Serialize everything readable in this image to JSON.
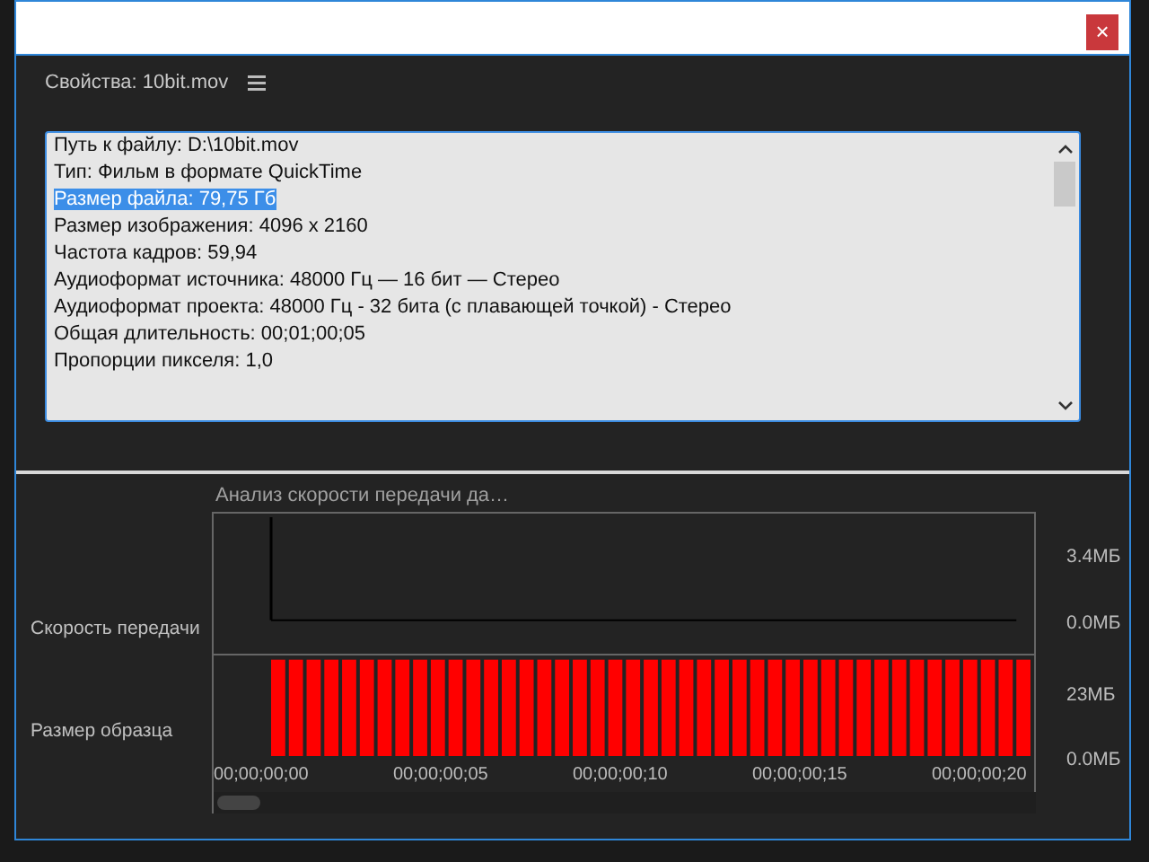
{
  "window": {
    "close_label": "×"
  },
  "panel": {
    "title": "Свойства: 10bit.mov"
  },
  "properties": [
    {
      "text": "Путь к файлу: D:\\10bit.mov",
      "selected": false
    },
    {
      "text": "Тип: Фильм в формате QuickTime",
      "selected": false
    },
    {
      "text": "Размер файла: 79,75 Гб",
      "selected": true
    },
    {
      "text": "Размер изображения: 4096 x 2160",
      "selected": false
    },
    {
      "text": "Частота кадров: 59,94",
      "selected": false
    },
    {
      "text": "Аудиоформат источника: 48000 Гц — 16 бит — Стерео",
      "selected": false
    },
    {
      "text": "Аудиоформат проекта: 48000 Гц - 32 бита (с плавающей точкой) - Стерео",
      "selected": false
    },
    {
      "text": "Общая длительность: 00;01;00;05",
      "selected": false
    },
    {
      "text": "Пропорции пикселя: 1,0",
      "selected": false
    }
  ],
  "analysis": {
    "title": "Анализ скорости передачи да…",
    "xticks": [
      "00;00;00;00",
      "00;00;00;05",
      "00;00;00;10",
      "00;00;00;15",
      "00;00;00;20"
    ],
    "charts": [
      {
        "label": "Скорость передачи",
        "chart_data": {
          "type": "line",
          "ylim": [
            -1.7,
            5.4
          ],
          "yticks": [
            {
              "value": 0,
              "label": "0.0МБ"
            },
            {
              "value": 3.4,
              "label": "3.4МБ"
            }
          ],
          "series": [
            {
              "color": "#000000",
              "values": [
                0,
                0,
                0,
                0,
                0,
                0,
                0,
                0,
                0,
                0,
                0,
                0,
                0,
                0,
                0,
                0,
                0,
                0,
                0,
                0,
                0,
                0,
                0,
                0,
                0,
                0,
                0,
                0,
                0,
                0,
                0,
                0,
                0,
                0,
                0,
                0,
                0,
                0,
                0,
                0,
                0,
                0,
                0
              ]
            }
          ]
        }
      },
      {
        "label": "Размер образца",
        "chart_data": {
          "type": "bar",
          "ylim": [
            0,
            36
          ],
          "yticks": [
            {
              "value": 0,
              "label": "0.0МБ"
            },
            {
              "value": 23,
              "label": "23МБ"
            }
          ],
          "series": [
            {
              "color": "#ff0000",
              "values": [
                34.5,
                34.5,
                34.5,
                34.5,
                34.5,
                34.5,
                34.5,
                34.5,
                34.5,
                34.5,
                34.5,
                34.5,
                34.5,
                34.5,
                34.5,
                34.5,
                34.5,
                34.5,
                34.5,
                34.5,
                34.5,
                34.5,
                34.5,
                34.5,
                34.5,
                34.5,
                34.5,
                34.5,
                34.5,
                34.5,
                34.5,
                34.5,
                34.5,
                34.5,
                34.5,
                34.5,
                34.5,
                34.5,
                34.5,
                34.5,
                34.5,
                34.5,
                34.5
              ]
            }
          ]
        }
      }
    ]
  }
}
